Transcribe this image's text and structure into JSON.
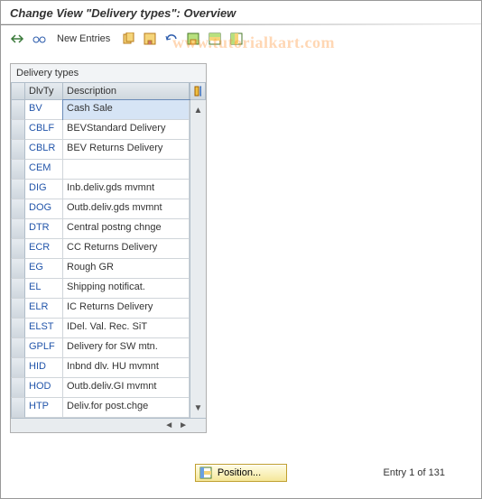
{
  "title": "Change View \"Delivery types\": Overview",
  "toolbar": {
    "new_entries": "New Entries"
  },
  "watermark": "www.tutorialkart.com",
  "panel": {
    "title": "Delivery types",
    "columns": {
      "dlvty": "DlvTy",
      "desc": "Description"
    },
    "rows": [
      {
        "dlvty": "BV",
        "desc": "Cash Sale",
        "selected": true
      },
      {
        "dlvty": "CBLF",
        "desc": "BEVStandard Delivery"
      },
      {
        "dlvty": "CBLR",
        "desc": "BEV Returns Delivery"
      },
      {
        "dlvty": "CEM",
        "desc": ""
      },
      {
        "dlvty": "DIG",
        "desc": "Inb.deliv.gds mvmnt"
      },
      {
        "dlvty": "DOG",
        "desc": "Outb.deliv.gds mvmnt"
      },
      {
        "dlvty": "DTR",
        "desc": "Central postng chnge"
      },
      {
        "dlvty": "ECR",
        "desc": "CC Returns Delivery"
      },
      {
        "dlvty": "EG",
        "desc": "Rough GR"
      },
      {
        "dlvty": "EL",
        "desc": "Shipping notificat."
      },
      {
        "dlvty": "ELR",
        "desc": "IC Returns Delivery"
      },
      {
        "dlvty": "ELST",
        "desc": "IDel. Val. Rec. SiT"
      },
      {
        "dlvty": "GPLF",
        "desc": "Delivery for SW mtn."
      },
      {
        "dlvty": "HID",
        "desc": "Inbnd dlv. HU mvmnt"
      },
      {
        "dlvty": "HOD",
        "desc": "Outb.deliv.GI mvmnt"
      },
      {
        "dlvty": "HTP",
        "desc": "Deliv.for post.chge"
      }
    ]
  },
  "footer": {
    "position_label": "Position...",
    "entry_text": "Entry 1 of 131"
  }
}
